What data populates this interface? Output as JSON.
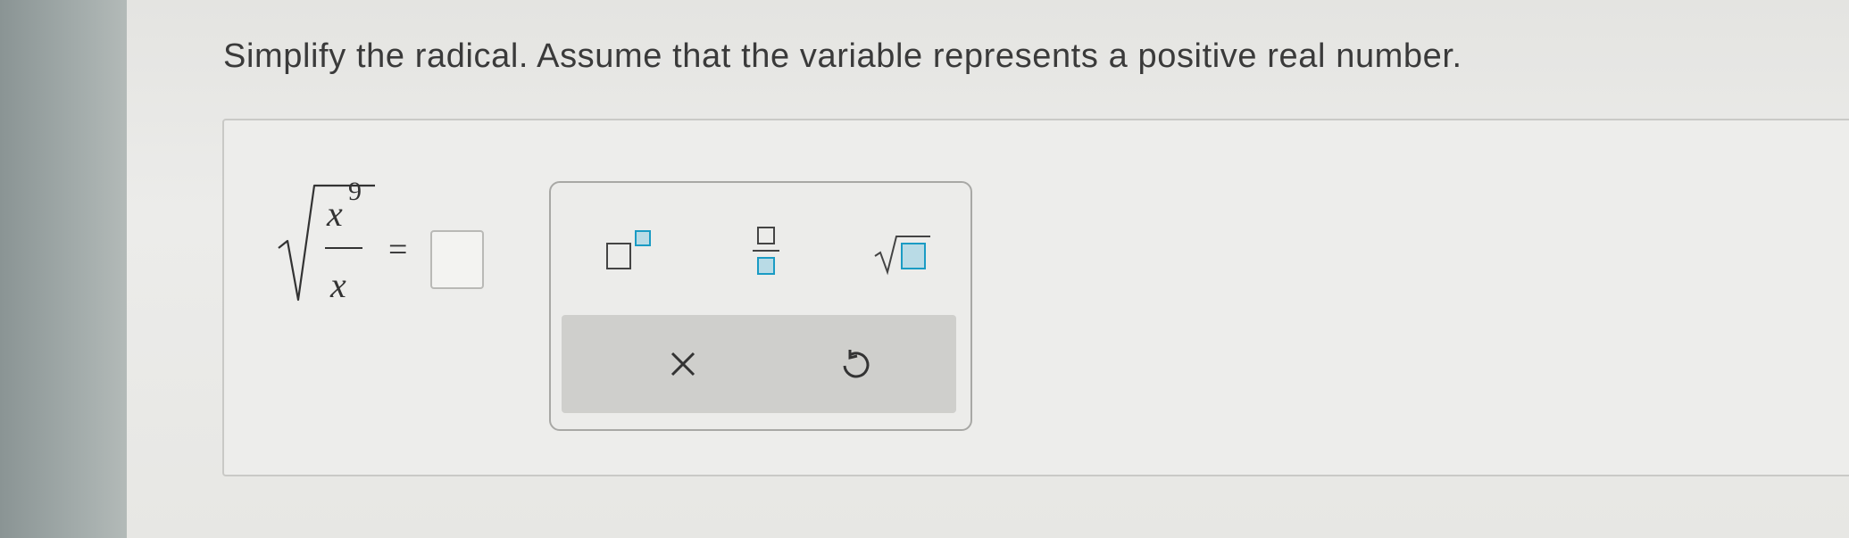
{
  "question": {
    "text": "Simplify the radical. Assume that the variable represents a positive real number."
  },
  "expression": {
    "numerator_base": "x",
    "numerator_exponent": "9",
    "denominator": "x",
    "equals": "="
  },
  "answer_input": {
    "value": ""
  },
  "palette": {
    "tools": [
      {
        "name": "exponent",
        "icon": "exponent-icon"
      },
      {
        "name": "fraction",
        "icon": "fraction-icon"
      },
      {
        "name": "square-root",
        "icon": "square-root-icon"
      }
    ],
    "clear_label": "×",
    "clear_icon": "close-icon",
    "reset_icon": "undo-icon"
  },
  "colors": {
    "accent_box": "#1a9bc4",
    "text": "#3a3a3a",
    "panel": "#cfcfcc"
  }
}
